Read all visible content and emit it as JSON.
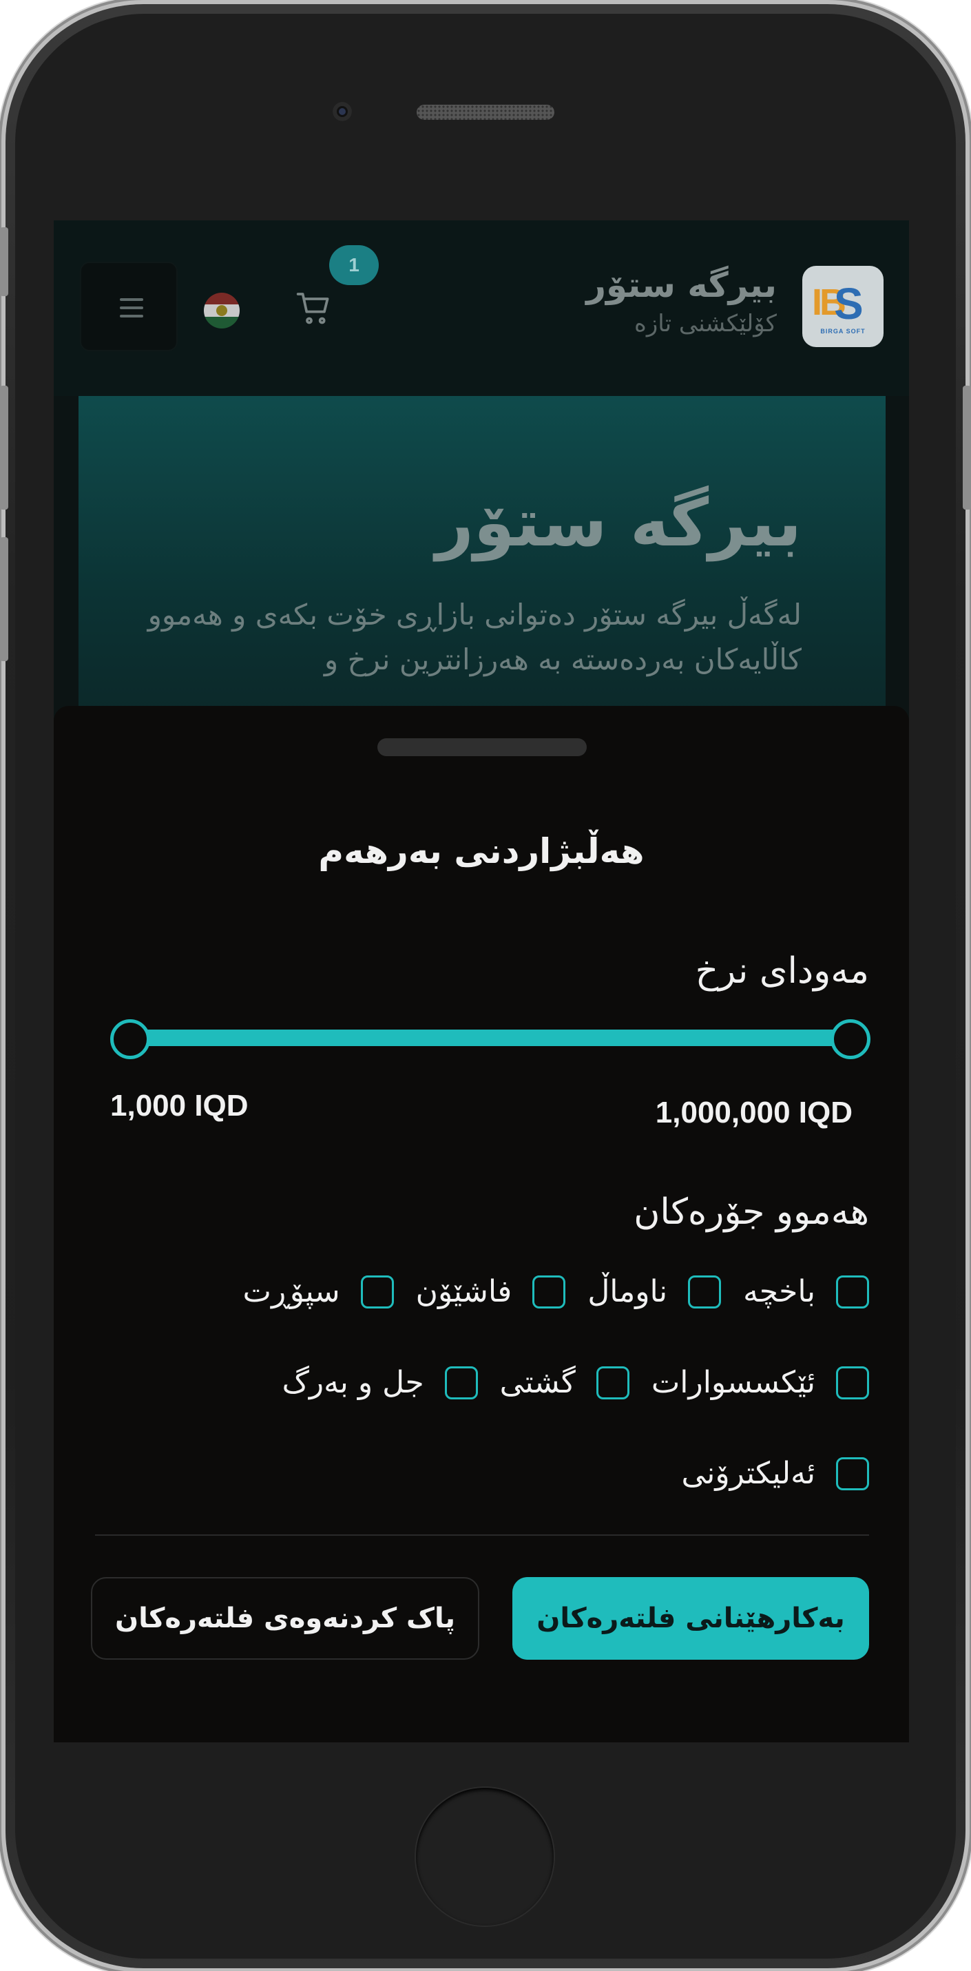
{
  "header": {
    "logo_text": "BIRGA SOFT",
    "brand_title": "بیرگە ستۆر",
    "brand_subtitle": "کۆلێکشنی تازە",
    "cart_count": "1"
  },
  "hero": {
    "title": "بیرگە ستۆر",
    "text": "لەگەڵ بیرگە ستۆر دەتوانی بازاڕی خۆت بکەی و هەموو کاڵایەکان بەردەستە بە هەرزانترین نرخ و"
  },
  "filter_sheet": {
    "title": "هەڵبژاردنی بەرهەم",
    "price_range": {
      "label": "مەودای نرخ",
      "min_label": "1,000 IQD",
      "max_label": "1,000,000 IQD",
      "min_value": 1000,
      "max_value": 1000000
    },
    "categories": {
      "label": "هەموو جۆرەکان",
      "rows": [
        [
          "باخچە",
          "ناوماڵ",
          "فاشێۆن",
          "سپۆڕت"
        ],
        [
          "ئێکسسوارات",
          "گشتی",
          "جل و بەرگ"
        ],
        [
          "ئەلیکترۆنی"
        ]
      ]
    },
    "apply_label": "بەکارهێنانی فلتەرەکان",
    "clear_label": "پاک کردنەوەی فلتەرەکان"
  },
  "colors": {
    "accent": "#1fbcbc",
    "sheet_bg": "#0c0b0a",
    "header_bg": "#0b1717"
  }
}
